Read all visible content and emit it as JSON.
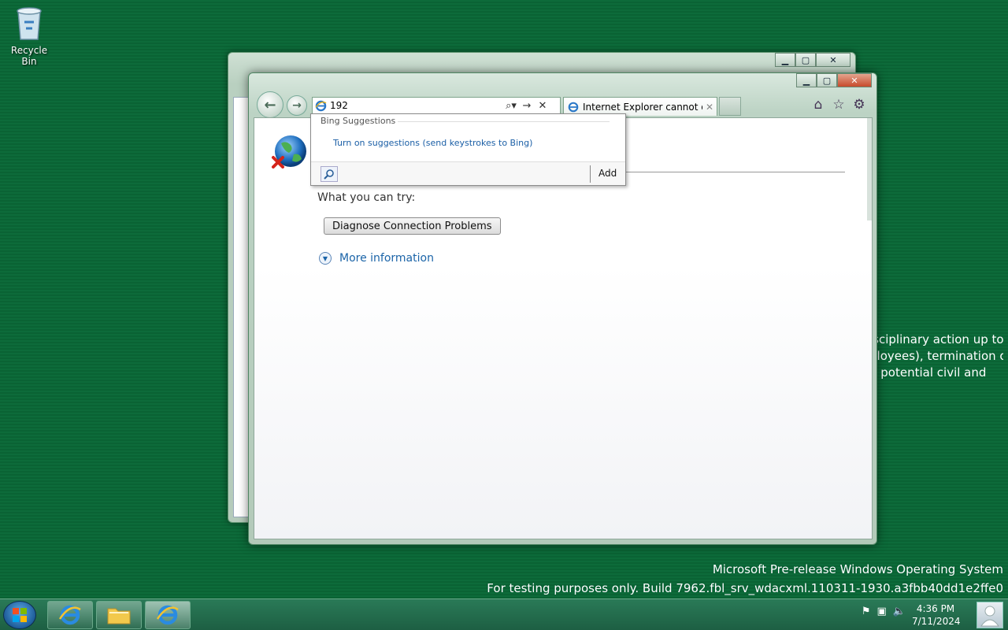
{
  "desktop": {
    "recycle_bin_label": "Recycle Bin",
    "watermark_title": "Microsoft Pre-release Windows Operating System",
    "watermark_build": "For testing purposes only. Build 7962.fbl_srv_wdacxml.110311-1930.a3fbb40dd1e2ffe0",
    "background_text": [
      "isciplinary action up to",
      "ployees), termination of",
      "d potential civil and"
    ]
  },
  "browser": {
    "address_value": "192",
    "tab_title": "Internet Explorer cannot dis...",
    "suggestions": {
      "header": "Bing Suggestions",
      "link": "Turn on suggestions (send keystrokes to Bing)",
      "add_label": "Add"
    },
    "page": {
      "try_text": "What you can try:",
      "diagnose_button": "Diagnose Connection Problems",
      "more_info": "More information"
    }
  },
  "taskbar": {
    "time": "4:36 PM",
    "date": "7/11/2024"
  },
  "colors": {
    "desktop_green": "#0d6b3a",
    "link_blue": "#1b64a8",
    "taskbar_green": "#1d5f43"
  }
}
